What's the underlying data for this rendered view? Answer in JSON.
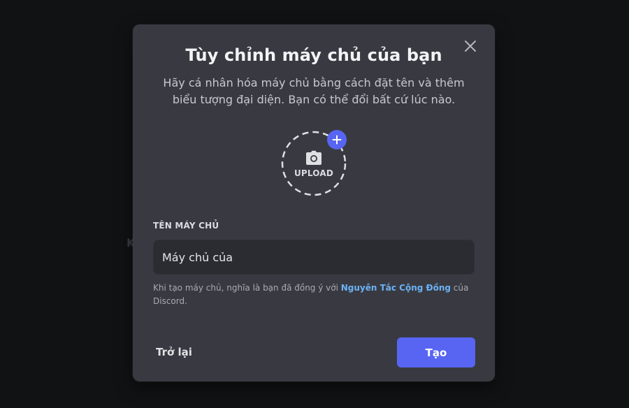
{
  "modal": {
    "title": "Tùy chỉnh máy chủ của bạn",
    "subtitle": "Hãy cá nhân hóa máy chủ bằng cách đặt tên và thêm biểu tượng đại diện. Bạn có thể đổi bất cứ lúc nào.",
    "close_icon": "close-icon"
  },
  "upload": {
    "label": "UPLOAD",
    "camera_icon": "camera-icon",
    "plus_icon": "plus-icon"
  },
  "form": {
    "server_name_label": "TÊN MÁY CHỦ",
    "server_name_value": "Máy chủ của"
  },
  "terms": {
    "prefix": "Khi tạo máy chủ, nghĩa là bạn đã đồng ý với ",
    "link": "Nguyên Tắc Cộng Đồng",
    "suffix": " của Discord."
  },
  "footer": {
    "back_label": "Trở lại",
    "create_label": "Tạo"
  },
  "colors": {
    "modal_bg": "#393a41",
    "accent": "#5865f2",
    "link": "#6cb2f5"
  }
}
